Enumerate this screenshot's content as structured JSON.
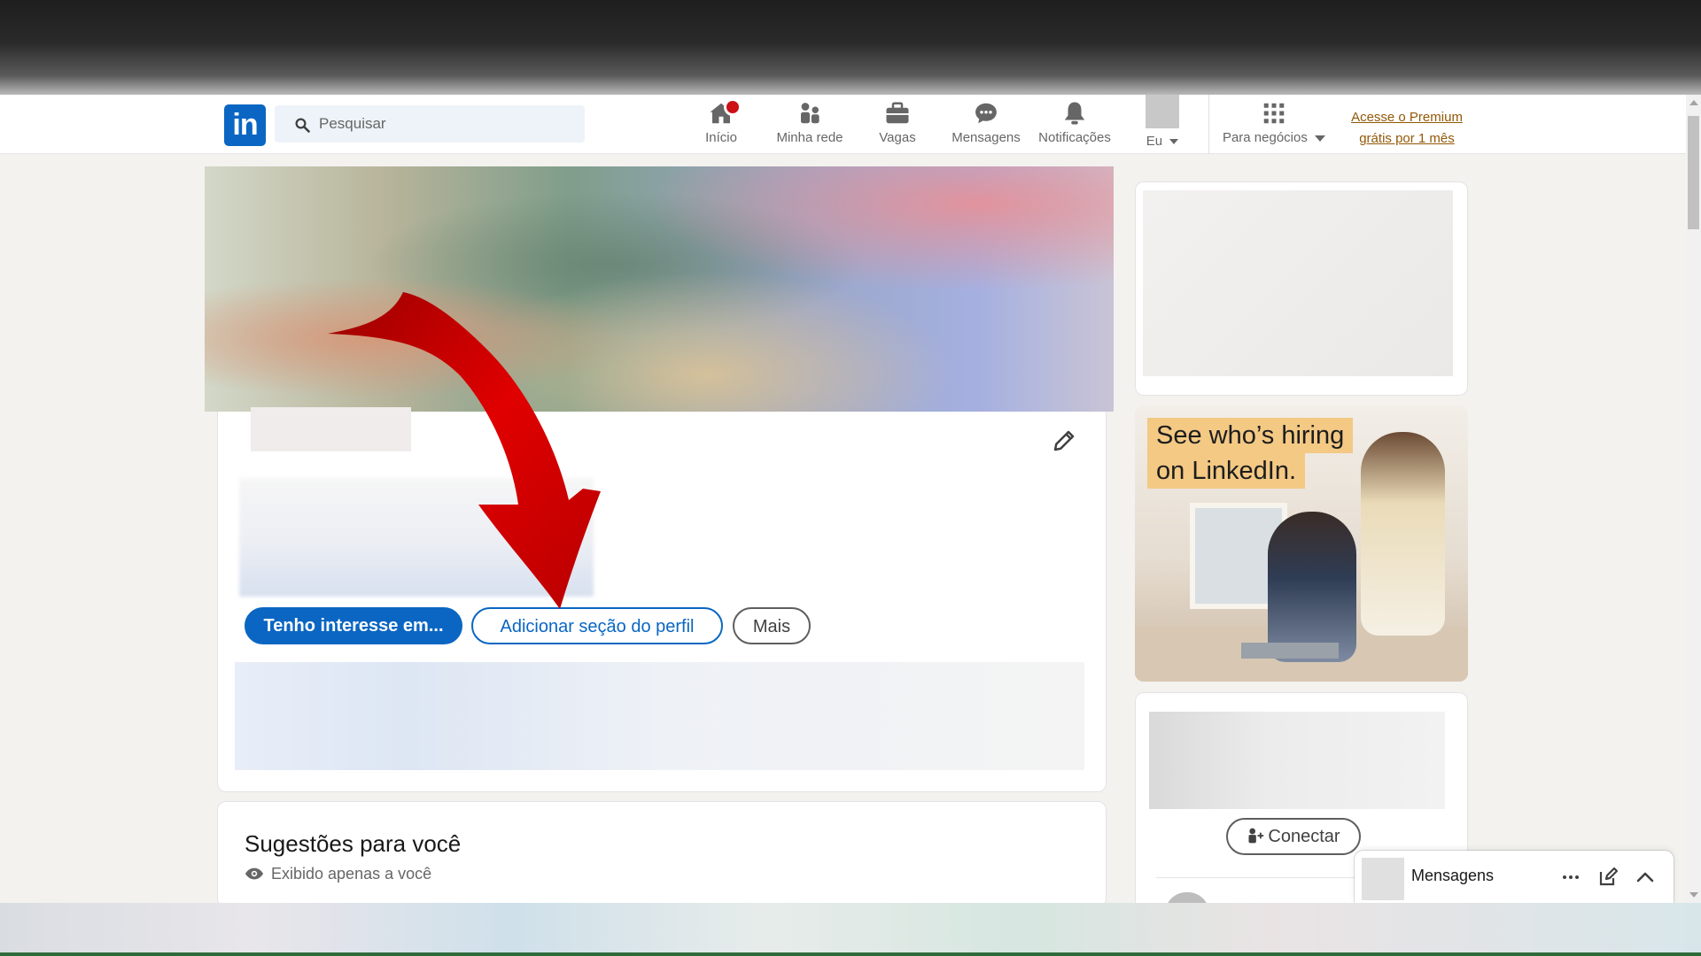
{
  "navbar": {
    "logo": "in",
    "search_placeholder": "Pesquisar",
    "items": [
      {
        "label": "Início",
        "icon": "home-icon"
      },
      {
        "label": "Minha rede",
        "icon": "network-icon"
      },
      {
        "label": "Vagas",
        "icon": "briefcase-icon"
      },
      {
        "label": "Mensagens",
        "icon": "chat-icon"
      },
      {
        "label": "Notificações",
        "icon": "bell-icon"
      },
      {
        "label": "Eu",
        "icon": "avatar"
      },
      {
        "label": "Para negócios",
        "icon": "grid-icon"
      }
    ],
    "premium_line1": "Acesse o Premium",
    "premium_line2": "grátis por 1 mês"
  },
  "profile": {
    "buttons": {
      "interest": "Tenho interesse em...",
      "add_section": "Adicionar seção do perfil",
      "more": "Mais"
    }
  },
  "suggestions": {
    "title": "Sugestões para você",
    "subtitle": "Exibido apenas a você"
  },
  "rail": {
    "ad_line1": "See who’s hiring",
    "ad_line2": "on LinkedIn.",
    "connect": "Conectar"
  },
  "messaging": {
    "title": "Mensagens"
  },
  "colors": {
    "brand": "#0a66c2",
    "premium": "#915907",
    "arrow": "#cc0000",
    "notification_badge": "#cc1016"
  }
}
